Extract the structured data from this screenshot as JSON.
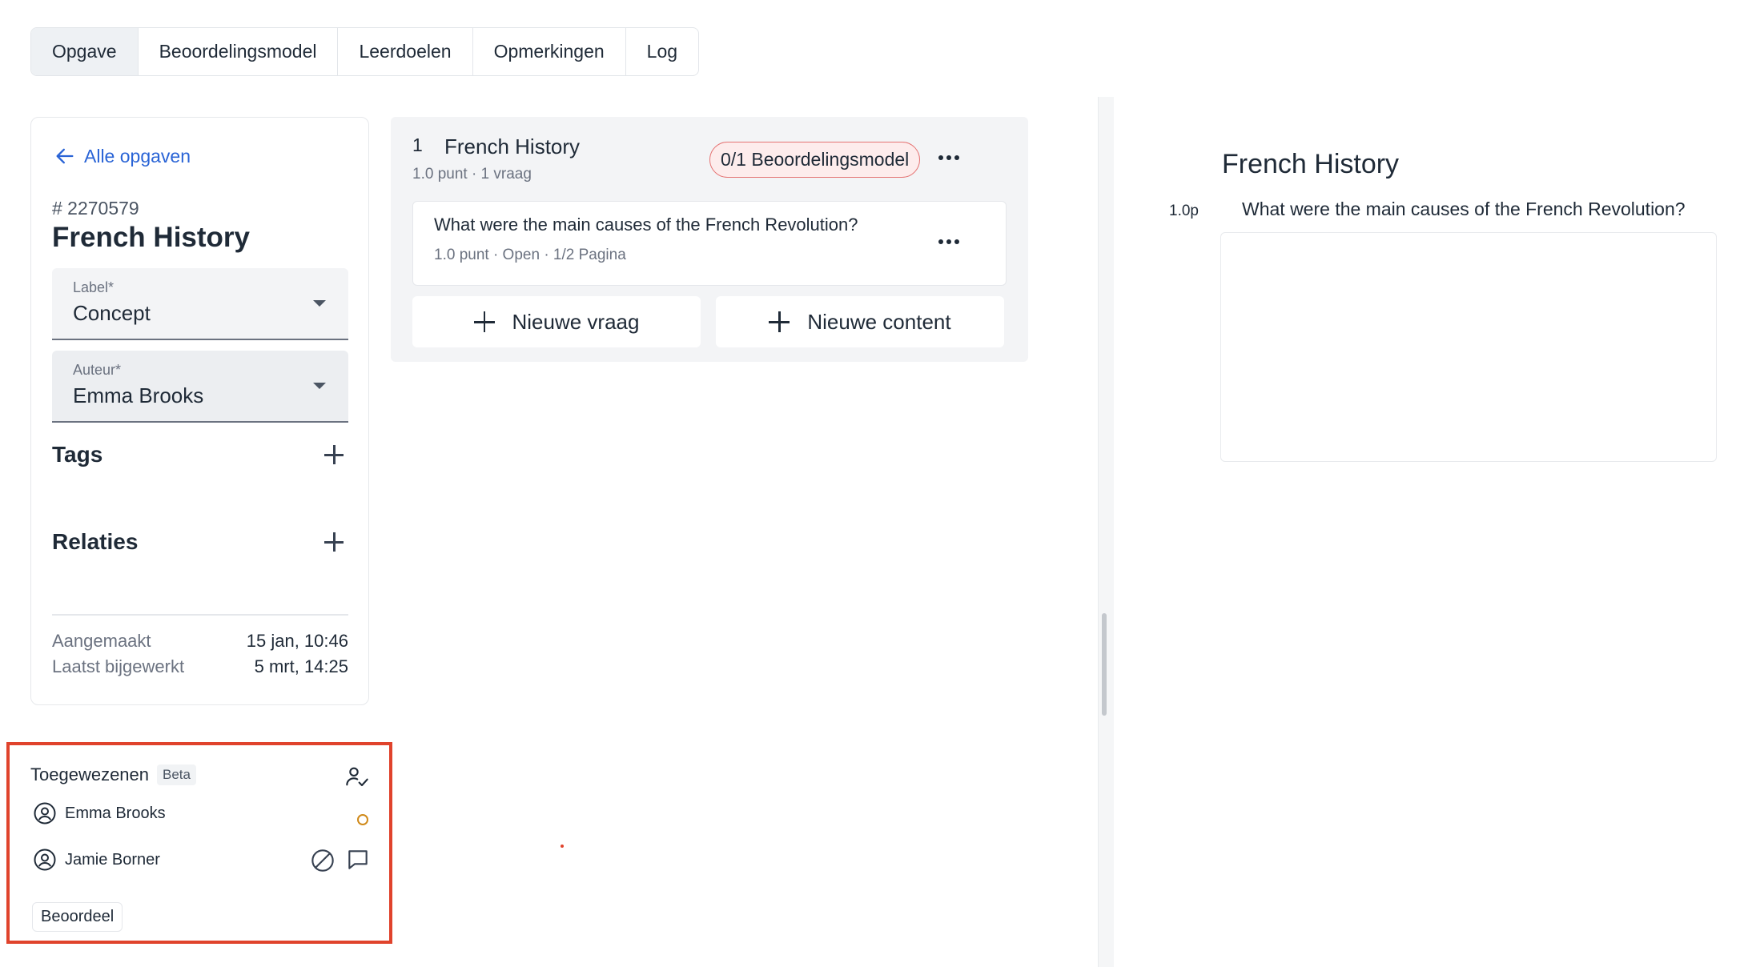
{
  "tabs": [
    {
      "label": "Opgave"
    },
    {
      "label": "Beoordelingsmodel"
    },
    {
      "label": "Leerdoelen"
    },
    {
      "label": "Opmerkingen"
    },
    {
      "label": "Log"
    }
  ],
  "sidebar": {
    "back_label": "Alle opgaven",
    "id": "# 2270579",
    "title": "French History",
    "label_field": {
      "label": "Label*",
      "value": "Concept"
    },
    "author_field": {
      "label": "Auteur*",
      "value": "Emma Brooks"
    },
    "tags_title": "Tags",
    "relations_title": "Relaties",
    "created_label": "Aangemaakt",
    "created_value": "15 jan, 10:46",
    "updated_label": "Laatst bijgewerkt",
    "updated_value": "5 mrt, 14:25"
  },
  "assigned": {
    "title": "Toegewezenen",
    "badge": "Beta",
    "people": [
      {
        "name": "Emma Brooks"
      },
      {
        "name": "Jamie Borner"
      }
    ],
    "action_label": "Beoordeel"
  },
  "question_group": {
    "number": "1",
    "title": "French History",
    "subtitle": "1.0 punt · 1 vraag",
    "rubric_badge": "0/1 Beoordelingsmodel",
    "question": {
      "text": "What were the main causes of the French Revolution?",
      "meta": "1.0 punt · Open · 1/2 Pagina"
    },
    "new_question_label": "Nieuwe vraag",
    "new_content_label": "Nieuwe content"
  },
  "preview": {
    "title": "French History",
    "points": "1.0p",
    "question": "What were the main causes of the French Revolution?"
  },
  "colors": {
    "accent_link": "#2a64d6",
    "highlight_border": "#e0432c",
    "rubric_border": "#e57373",
    "status_circle": "#d08a1a"
  }
}
